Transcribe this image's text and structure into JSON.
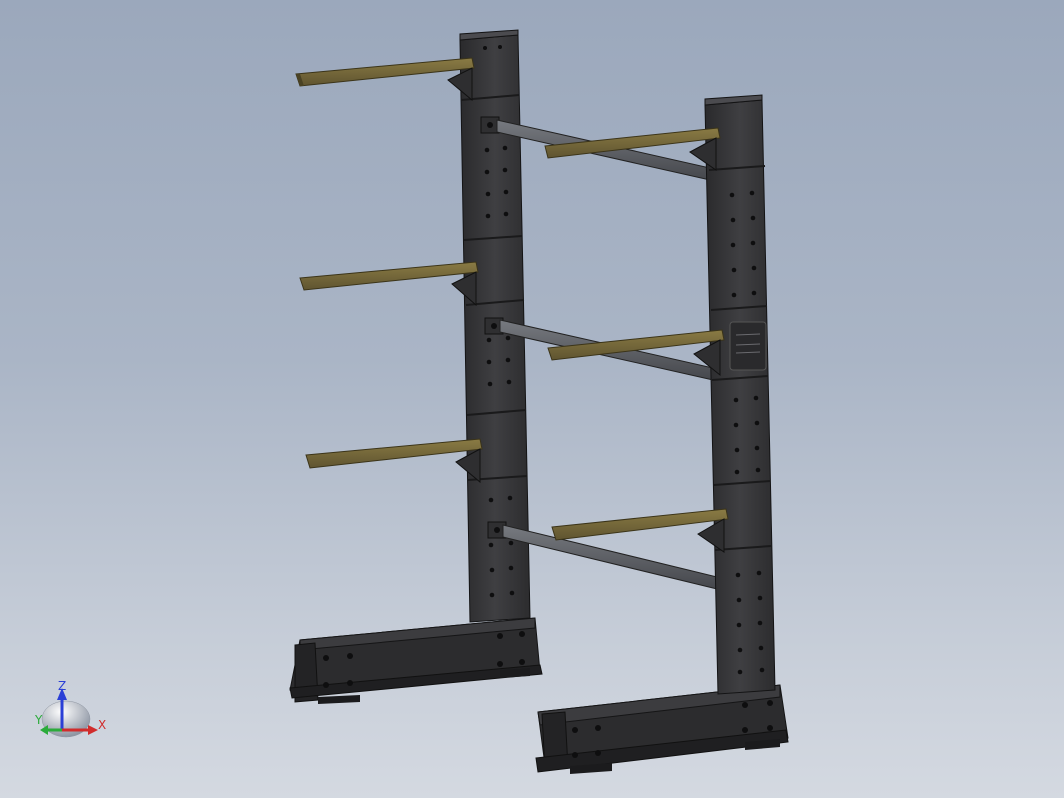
{
  "view": {
    "background_top": "#9ba8bc",
    "background_bottom": "#d4d9e1"
  },
  "model": {
    "frame_color": "#3a3a3c",
    "frame_dark": "#252527",
    "arm_color": "#756839",
    "arm_dark": "#574c29",
    "brace_color": "#5b5d62"
  },
  "triad": {
    "x_label": "X",
    "y_label": "Y",
    "z_label": "Z",
    "x_color": "#d12c2c",
    "y_color": "#2bab3b",
    "z_color": "#2a3fd6"
  }
}
